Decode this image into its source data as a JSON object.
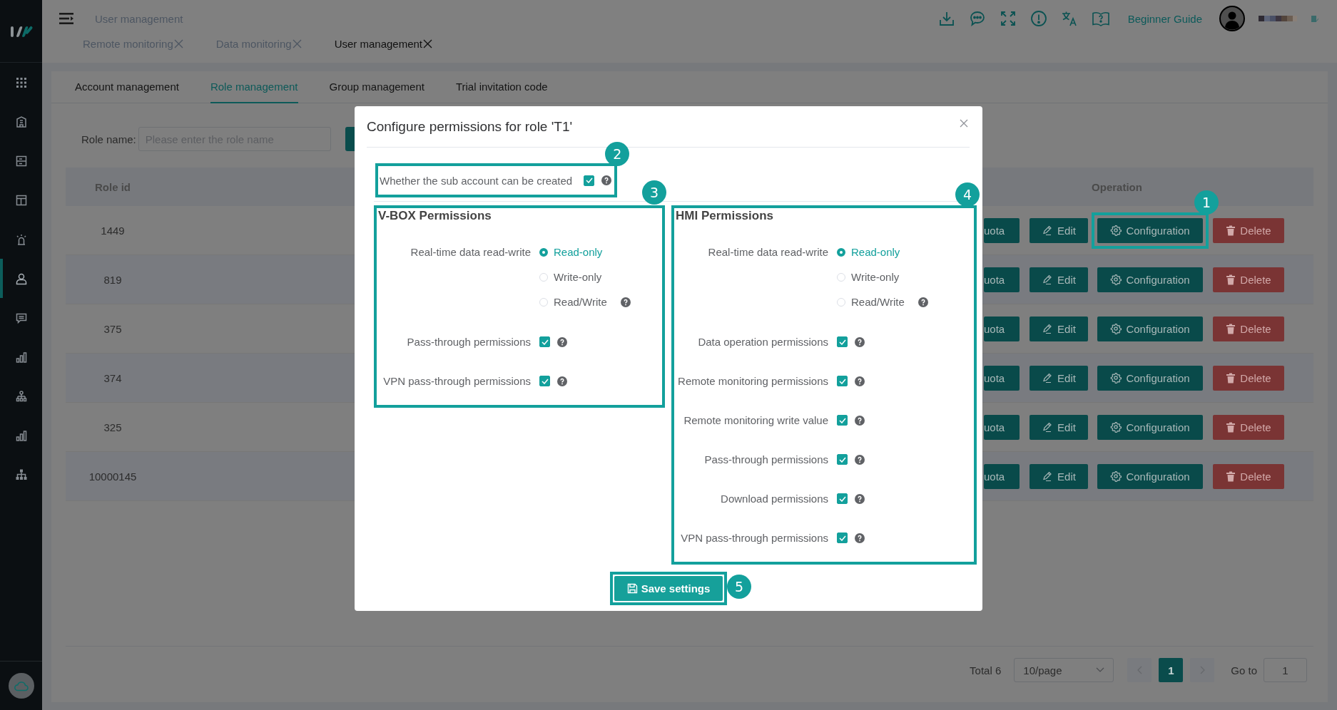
{
  "sidebar": {
    "items": [
      {
        "kind": "grid",
        "selected": false
      },
      {
        "kind": "building",
        "selected": false
      },
      {
        "kind": "list",
        "selected": false
      },
      {
        "kind": "layout",
        "selected": false
      },
      {
        "kind": "alarm",
        "selected": false
      },
      {
        "kind": "user",
        "selected": true
      },
      {
        "kind": "message",
        "selected": false
      },
      {
        "kind": "bar-chart",
        "selected": false
      },
      {
        "kind": "network",
        "selected": false
      },
      {
        "kind": "bar-chart",
        "selected": false
      },
      {
        "kind": "hierarchy",
        "selected": false
      }
    ]
  },
  "header": {
    "breadcrumb": "User management",
    "guide_link": "Beginner Guide",
    "tabs": [
      {
        "label": "Remote monitoring",
        "selected": false
      },
      {
        "label": "Data monitoring",
        "selected": false
      },
      {
        "label": "User management",
        "selected": true
      }
    ]
  },
  "subtabs": [
    {
      "label": "Account management",
      "selected": false
    },
    {
      "label": "Role management",
      "selected": true
    },
    {
      "label": "Group management",
      "selected": false
    },
    {
      "label": "Trial invitation code",
      "selected": false
    }
  ],
  "filter": {
    "label": "Role name:",
    "placeholder": "Please enter the role name"
  },
  "table": {
    "columns": [
      "Role id",
      "Operation"
    ],
    "rows": [
      {
        "role_id": "1449",
        "callout": "1",
        "actions": [
          {
            "kind": "quota",
            "label": "uota"
          },
          {
            "kind": "edit",
            "label": "Edit"
          },
          {
            "kind": "config",
            "label": "Configuration"
          },
          {
            "kind": "delete",
            "label": "Delete"
          }
        ]
      },
      {
        "role_id": "819",
        "actions": [
          {
            "kind": "quota",
            "label": "uota"
          },
          {
            "kind": "edit",
            "label": "Edit"
          },
          {
            "kind": "config",
            "label": "Configuration"
          },
          {
            "kind": "delete",
            "label": "Delete"
          }
        ]
      },
      {
        "role_id": "375",
        "actions": [
          {
            "kind": "quota",
            "label": "uota"
          },
          {
            "kind": "edit",
            "label": "Edit"
          },
          {
            "kind": "config",
            "label": "Configuration"
          },
          {
            "kind": "delete",
            "label": "Delete"
          }
        ]
      },
      {
        "role_id": "374",
        "actions": [
          {
            "kind": "quota",
            "label": "uota"
          },
          {
            "kind": "edit",
            "label": "Edit"
          },
          {
            "kind": "config",
            "label": "Configuration"
          },
          {
            "kind": "delete",
            "label": "Delete"
          }
        ]
      },
      {
        "role_id": "325",
        "actions": [
          {
            "kind": "quota",
            "label": "uota"
          },
          {
            "kind": "edit",
            "label": "Edit"
          },
          {
            "kind": "config",
            "label": "Configuration"
          },
          {
            "kind": "delete",
            "label": "Delete"
          }
        ]
      },
      {
        "role_id": "10000145",
        "actions": [
          {
            "kind": "quota",
            "label": "uota"
          },
          {
            "kind": "edit",
            "label": "Edit"
          },
          {
            "kind": "config",
            "label": "Configuration"
          },
          {
            "kind": "delete",
            "label": "Delete"
          }
        ]
      }
    ]
  },
  "pagination": {
    "total": "Total 6",
    "page_size": "10/page",
    "pages": [
      {
        "label": "1",
        "selected": true
      }
    ],
    "goto_label": "Go to",
    "goto_value": "1"
  },
  "dialog": {
    "title": "Configure permissions for role 'T1'",
    "sub_account": {
      "label": "Whether the sub account can be created",
      "checked": true,
      "callout": "2"
    },
    "panels": [
      {
        "title": "V-BOX Permissions",
        "callout": "3",
        "radio": {
          "label": "Real-time data read-write",
          "options": [
            {
              "label": "Read-only",
              "selected": true
            },
            {
              "label": "Write-only",
              "selected": false
            },
            {
              "label": "Read/Write",
              "selected": false
            }
          ]
        },
        "checks": [
          {
            "label": "Pass-through permissions",
            "checked": true
          },
          {
            "label": "VPN pass-through permissions",
            "checked": true
          }
        ]
      },
      {
        "title": "HMI Permissions",
        "callout": "4",
        "radio": {
          "label": "Real-time data read-write",
          "options": [
            {
              "label": "Read-only",
              "selected": true
            },
            {
              "label": "Write-only",
              "selected": false
            },
            {
              "label": "Read/Write",
              "selected": false
            }
          ]
        },
        "checks": [
          {
            "label": "Data operation permissions",
            "checked": true
          },
          {
            "label": "Remote monitoring permissions",
            "checked": true
          },
          {
            "label": "Remote monitoring write value",
            "checked": true
          },
          {
            "label": "Pass-through permissions",
            "checked": true
          },
          {
            "label": "Download permissions",
            "checked": true
          },
          {
            "label": "VPN pass-through permissions",
            "checked": true
          }
        ]
      }
    ],
    "save": {
      "label": "Save settings",
      "callout": "5"
    }
  }
}
